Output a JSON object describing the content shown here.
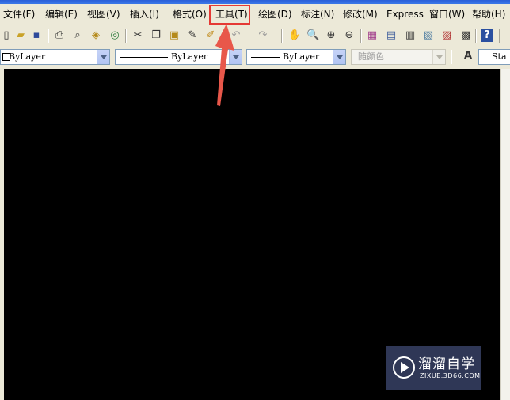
{
  "menubar": {
    "items": [
      "文件(F)",
      "编辑(E)",
      "视图(V)",
      "插入(I)",
      "格式(O)",
      "工具(T)",
      "绘图(D)",
      "标注(N)",
      "修改(M)",
      "Express",
      "窗口(W)",
      "帮助(H)"
    ]
  },
  "propbar": {
    "layer_value": "ByLayer",
    "linetype_value": "ByLayer",
    "lineweight_value": "ByLayer",
    "color_value": "随颜色",
    "style_value": "Sta"
  },
  "watermark": {
    "title": "溜溜自学",
    "subtitle": "ZIXUE.3D66.COM"
  },
  "colors": {
    "highlight": "#e53935",
    "canvas": "#000000"
  }
}
